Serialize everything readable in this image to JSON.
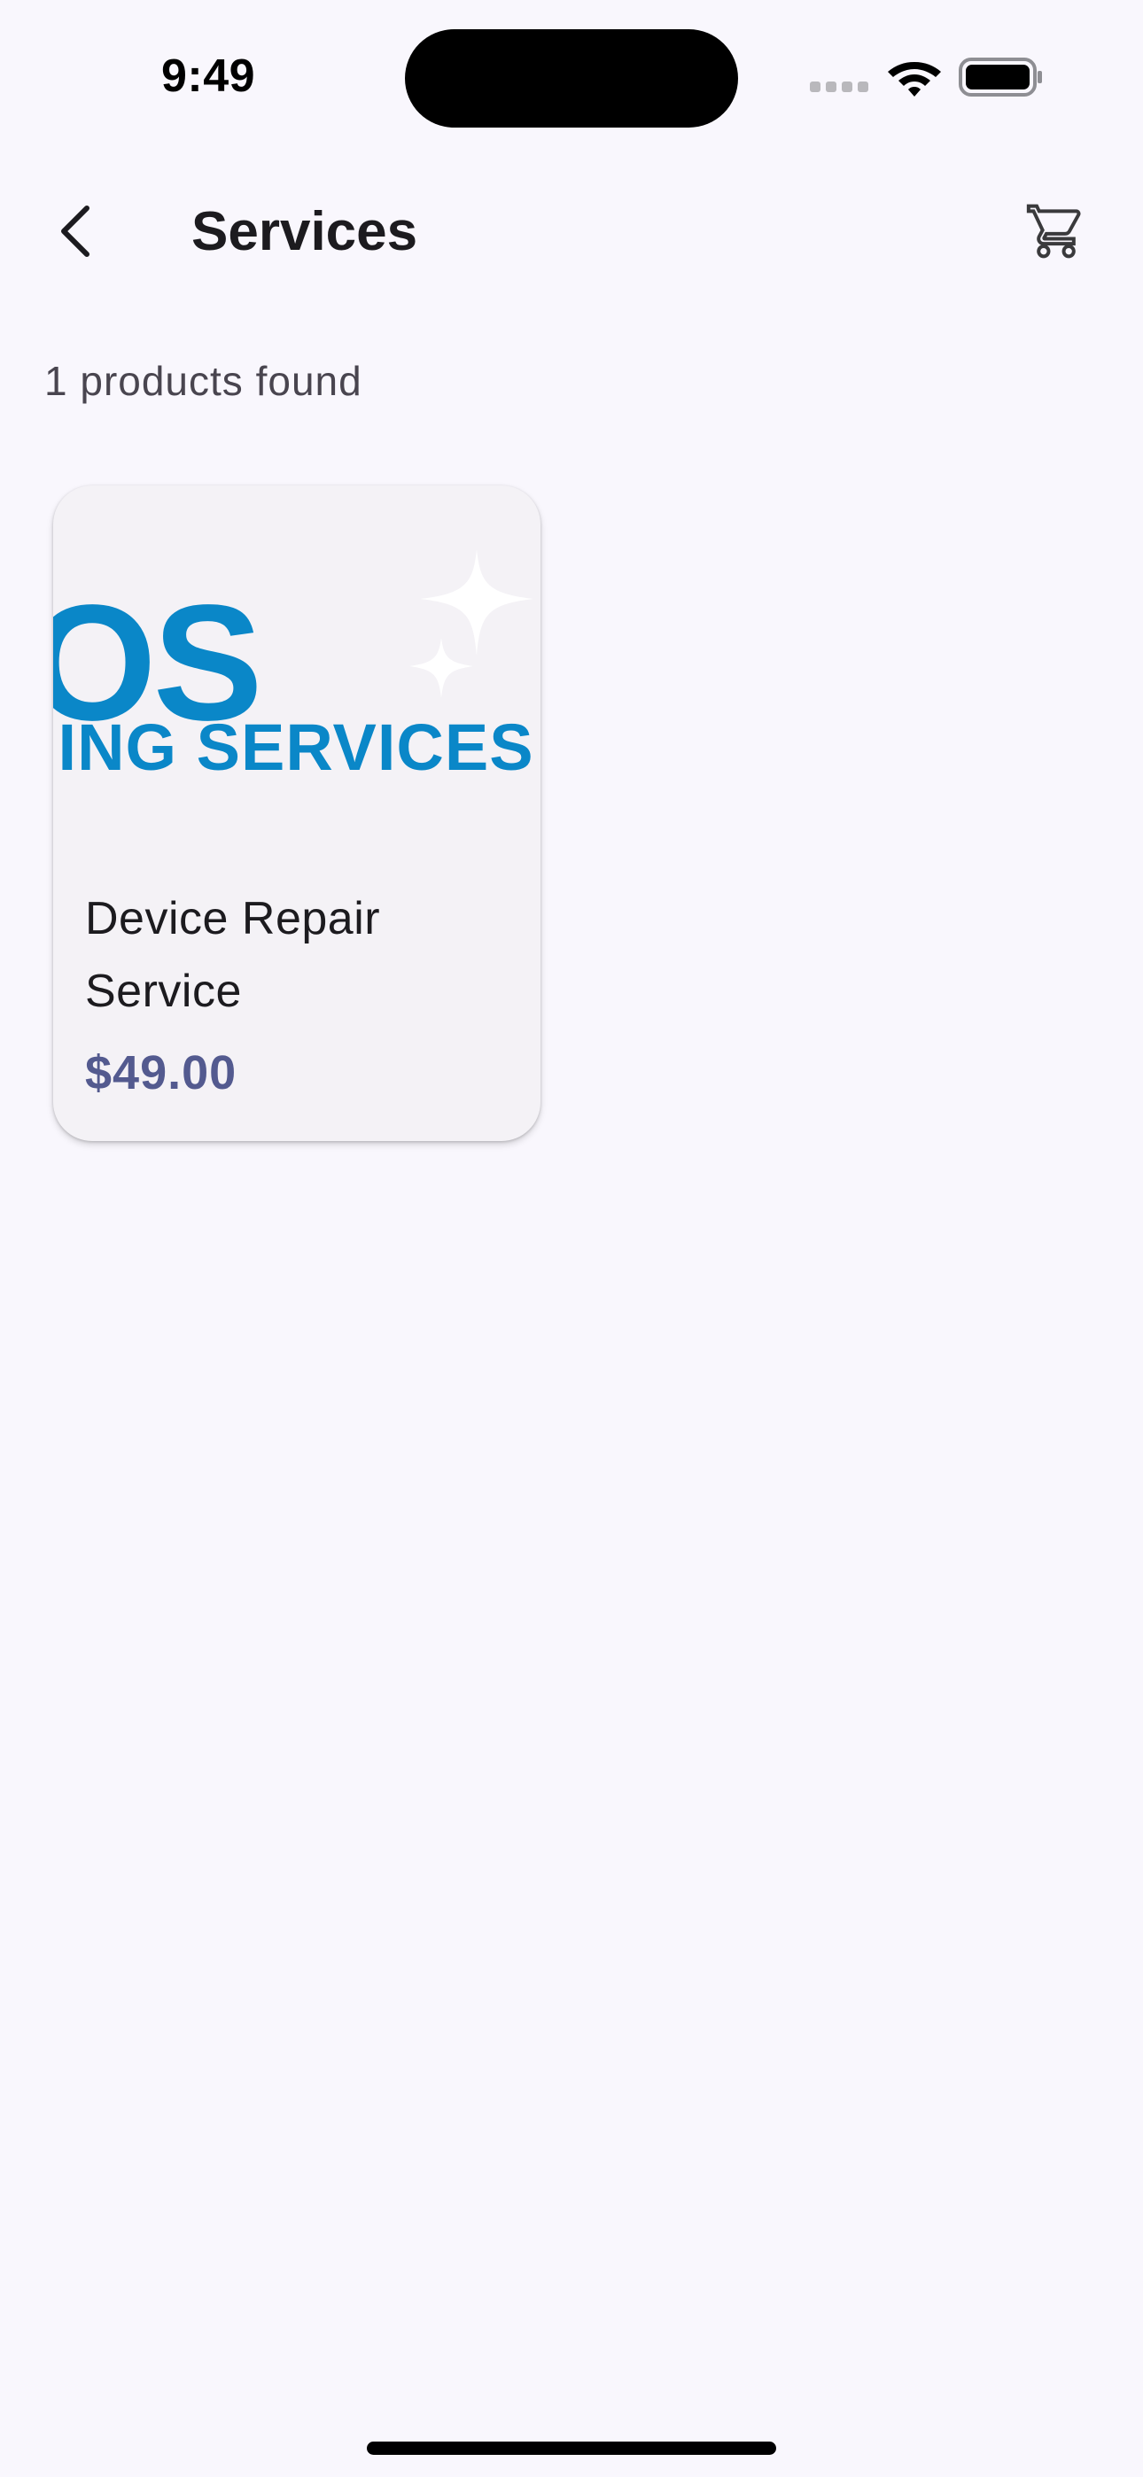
{
  "status_bar": {
    "time": "9:49",
    "icons": [
      "cellular-signal-icon",
      "wifi-icon",
      "battery-icon"
    ]
  },
  "header": {
    "title": "Services",
    "back_icon": "chevron-left-icon",
    "cart_icon": "shopping-cart-icon"
  },
  "results": {
    "count_text": "1 products found"
  },
  "products": [
    {
      "image_logo_line1": "OS",
      "image_logo_line2": "IING SERVICES",
      "name": "Device Repair Service",
      "price": "$49.00"
    }
  ],
  "colors": {
    "background": "#f9f7fd",
    "card_background": "#f4f2f6",
    "price": "#535a8f",
    "logo_blue": "#0a87c8",
    "text_primary": "#1c1b1f",
    "text_secondary": "#49454f"
  }
}
